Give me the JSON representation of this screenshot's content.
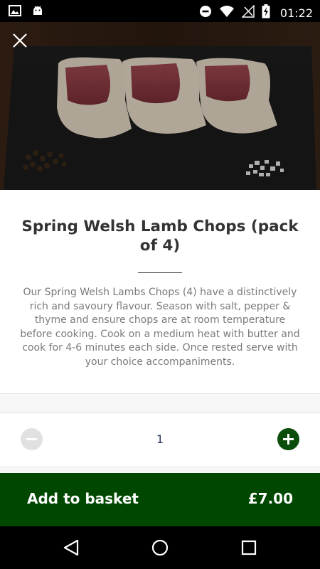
{
  "status_bar": {
    "time": "01:22",
    "left_icons": [
      "image-icon",
      "android-icon"
    ],
    "right_icons": [
      "do-not-disturb-icon",
      "wifi-icon",
      "no-signal-icon",
      "battery-charging-icon"
    ]
  },
  "hero": {
    "close_icon": "close-icon"
  },
  "product": {
    "title": "Spring Welsh Lamb Chops (pack of 4)",
    "description": "Our Spring Welsh Lambs Chops (4) have a distinctively rich and savoury flavour. Season with salt, pepper & thyme and ensure chops are at room temperature before cooking. Cook on a medium heat with butter and cook for 4-6 minutes each side. Once rested serve with your choice accompaniments."
  },
  "quantity": {
    "value": "1",
    "minus_icon": "minus-circle-icon",
    "plus_icon": "plus-circle-icon"
  },
  "basket": {
    "label": "Add to basket",
    "price": "£7.00"
  },
  "nav_bar": {
    "buttons": [
      "back-icon",
      "home-icon",
      "recents-icon"
    ]
  },
  "colors": {
    "accent_green": "#004800",
    "plus_green": "#0b4d0b",
    "title_text": "#333333",
    "body_text": "#7a7a7a"
  }
}
